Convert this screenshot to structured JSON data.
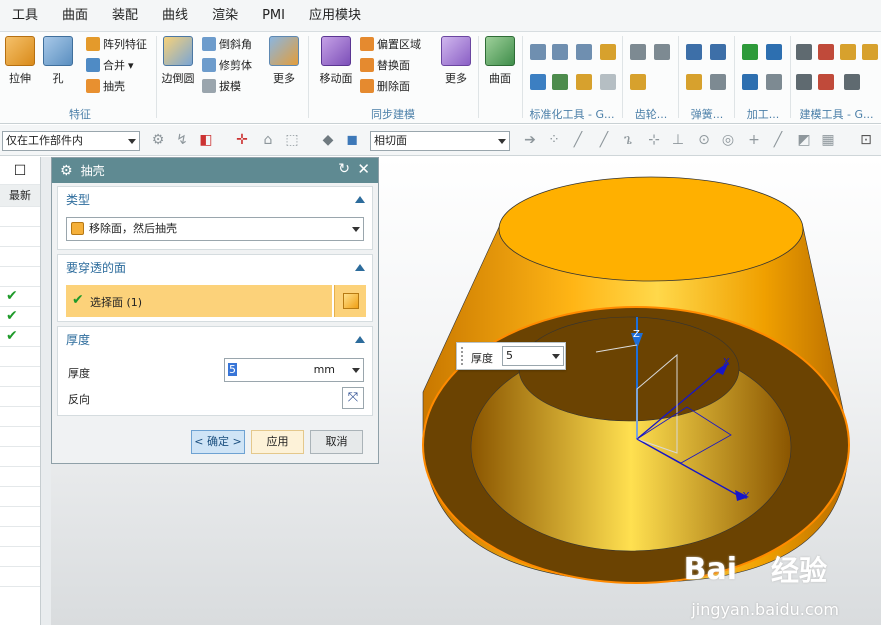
{
  "menubar": {
    "items": [
      "工具",
      "曲面",
      "装配",
      "曲线",
      "渲染",
      "PMI",
      "应用模块"
    ]
  },
  "ribbon": {
    "feature": {
      "extrude": "拉伸",
      "hole": "孔",
      "pattern": "阵列特征",
      "unite": "合并",
      "shell": "抽壳",
      "group_label": "特征"
    },
    "edge": {
      "edge_blend": "边倒圆",
      "chamfer": "倒斜角",
      "trim_body": "修剪体",
      "draft": "拔模",
      "more": "更多"
    },
    "sync": {
      "move_face": "移动面",
      "offset_region": "偏置区域",
      "replace_face": "替换面",
      "delete_face": "删除面",
      "more": "更多",
      "group_label": "同步建模"
    },
    "surface": {
      "label": "曲面"
    },
    "groups": {
      "standard": "标准化工具 - G...",
      "gear": "齿轮...",
      "spring": "弹簧...",
      "machining": "加工...",
      "modeling": "建模工具 - G..."
    }
  },
  "toolbar2": {
    "selection_scope": "仅在工作部件内",
    "face_rule": "相切面"
  },
  "left_strip": {
    "header": "最新",
    "checks": [
      "✔",
      "✔",
      "✔"
    ]
  },
  "dialog": {
    "title": "抽壳",
    "type_section": {
      "title": "类型",
      "value": "移除面，然后抽壳"
    },
    "face_section": {
      "title": "要穿透的面",
      "select_label": "选择面 (1)"
    },
    "thickness_section": {
      "title": "厚度",
      "thickness_label": "厚度",
      "thickness_value": "5",
      "unit": "mm",
      "reverse_label": "反向"
    },
    "buttons": {
      "ok": "< 确定 >",
      "apply": "应用",
      "cancel": "取消"
    }
  },
  "callout": {
    "label": "厚度",
    "value": "5"
  },
  "axes": {
    "z": "Z",
    "x": "X",
    "y": "Y"
  },
  "watermark": {
    "brand": "Bai",
    "brand2": "经验",
    "url": "jingyan.baidu.com"
  },
  "colors": {
    "accent": "#5f8a92",
    "shell_orange": "#f5a300",
    "shell_inner": "#6b4302",
    "ok_button": "#cfe4f6"
  }
}
